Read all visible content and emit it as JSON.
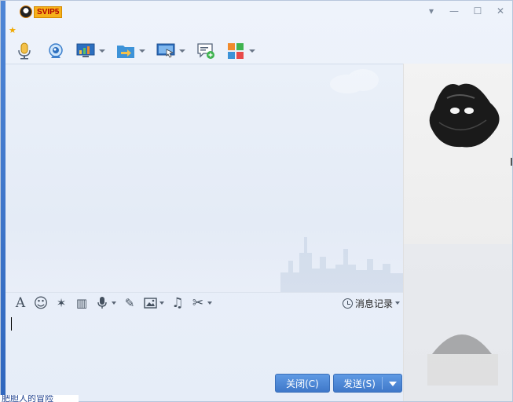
{
  "title_bar": {
    "vip_label": "SVIP5",
    "min_glyph": "—",
    "max_glyph": "☐",
    "close_glyph": "✕",
    "menu_glyph": "▾"
  },
  "toolbar": {
    "items": [
      {
        "icon": "microphone-icon",
        "has_dropdown": false
      },
      {
        "icon": "webcam-icon",
        "has_dropdown": false
      },
      {
        "icon": "screen-share-icon",
        "has_dropdown": true
      },
      {
        "icon": "file-transfer-icon",
        "has_dropdown": true
      },
      {
        "icon": "remote-desktop-icon",
        "has_dropdown": true
      },
      {
        "icon": "add-chat-icon",
        "has_dropdown": false
      },
      {
        "icon": "apps-icon",
        "has_dropdown": true
      }
    ]
  },
  "input_toolbar": {
    "items": [
      {
        "icon": "font-icon",
        "glyph": "A",
        "has_dropdown": false
      },
      {
        "icon": "emoji-icon",
        "glyph": "☺",
        "has_dropdown": false
      },
      {
        "icon": "magic-wand-icon",
        "glyph": "✶",
        "has_dropdown": false
      },
      {
        "icon": "shake-window-icon",
        "glyph": "▥",
        "has_dropdown": false
      },
      {
        "icon": "voice-message-icon",
        "glyph": "♆",
        "has_dropdown": true
      },
      {
        "icon": "edit-icon",
        "glyph": "✎",
        "has_dropdown": false
      },
      {
        "icon": "image-icon",
        "glyph": "▣",
        "has_dropdown": true
      },
      {
        "icon": "music-icon",
        "glyph": "♫",
        "has_dropdown": false
      },
      {
        "icon": "screenshot-scissors-icon",
        "glyph": "✂",
        "has_dropdown": true
      }
    ],
    "history_label": "消息记录"
  },
  "buttons": {
    "close_label": "关闭(C)",
    "send_label": "发送(S)"
  },
  "bottom_text": "肥胆人的冒险",
  "colors": {
    "primary_button": "#4a86d6",
    "accent_strip": "#3a72c8",
    "window_bg": "#e9eef8"
  }
}
